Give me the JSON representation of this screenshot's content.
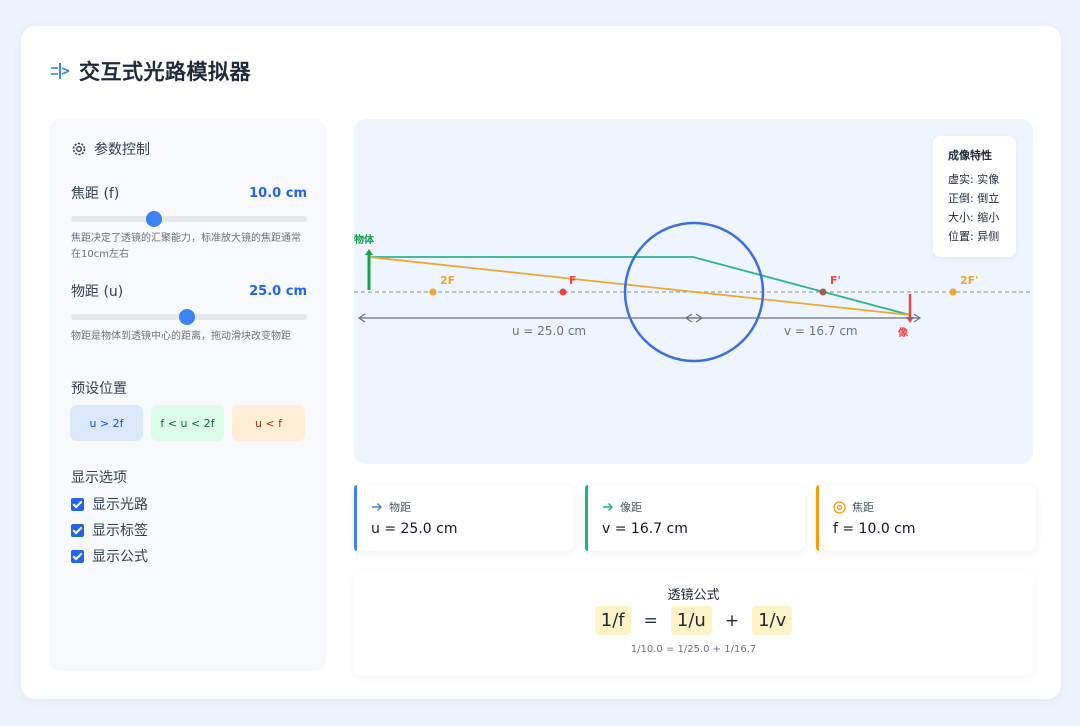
{
  "app": {
    "title": "交互式光路模拟器"
  },
  "controls": {
    "header": "参数控制",
    "focal": {
      "label": "焦距 (f)",
      "value": "10.0 cm",
      "fraction": 0.35,
      "desc": "焦距决定了透镜的汇聚能力，标准放大镜的焦距通常在10cm左右"
    },
    "object": {
      "label": "物距 (u)",
      "value": "25.0 cm",
      "fraction": 0.49,
      "desc": "物距是物体到透镜中心的距离，拖动滑块改变物距"
    },
    "presets_title": "预设位置",
    "presets": [
      "u > 2f",
      "f < u < 2f",
      "u < f"
    ],
    "display_title": "显示选项",
    "options": [
      {
        "label": "显示光路",
        "checked": true
      },
      {
        "label": "显示标签",
        "checked": true
      },
      {
        "label": "显示公式",
        "checked": true
      }
    ]
  },
  "simulation": {
    "labels": {
      "object": "物体",
      "image": "像",
      "f_left": "F",
      "f_right": "F'",
      "f2_left": "2F",
      "f2_right": "2F'"
    },
    "u_label": "u = 25.0 cm",
    "v_label": "v = 16.7 cm",
    "info": {
      "title": "成像特性",
      "lines": [
        "虚实: 实像",
        "正倒: 倒立",
        "大小: 缩小",
        "位置: 异侧"
      ]
    },
    "colors": {
      "lens": "#3b6fe0",
      "object": "#16a34a",
      "image": "#ef4444",
      "ray1": "#2bb58a",
      "ray2": "#f0a630"
    }
  },
  "metrics": [
    {
      "label": "物距",
      "value": "u = 25.0 cm",
      "icon": "arrow-right-icon",
      "color": "#3b82f6"
    },
    {
      "label": "像距",
      "value": "v = 16.7 cm",
      "icon": "arrow-right-icon",
      "color": "#10b981"
    },
    {
      "label": "焦距",
      "value": "f = 10.0 cm",
      "icon": "target-icon",
      "color": "#f59e0b"
    }
  ],
  "formula": {
    "title": "透镜公式",
    "terms": [
      "1/f",
      "1/u",
      "1/v"
    ],
    "ops": [
      "=",
      "+"
    ],
    "calc": "1/10.0 = 1/25.0 + 1/16.7"
  }
}
